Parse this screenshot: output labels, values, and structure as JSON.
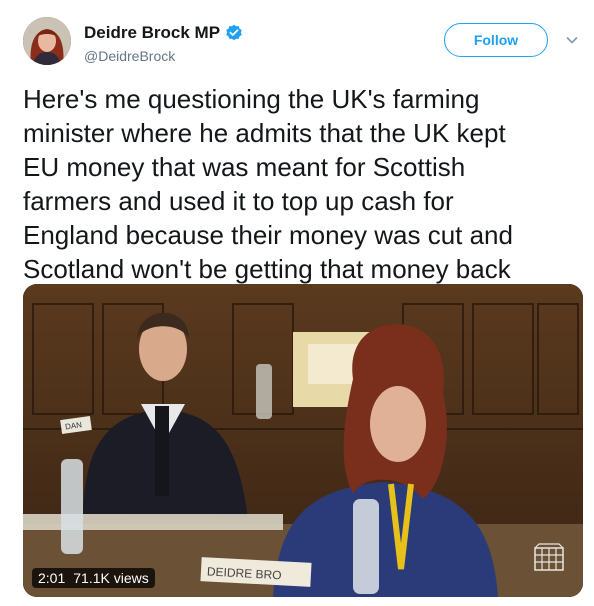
{
  "header": {
    "display_name": "Deidre Brock MP",
    "handle": "@DeidreBrock",
    "follow_label": "Follow"
  },
  "tweet": {
    "lines": [
      "Here's me questioning the UK's farming",
      "minister where he admits that the UK kept",
      "EU money that was meant for Scottish",
      "farmers and used it to top up cash for",
      "England because their money was cut and",
      "Scotland won't be getting that money back"
    ]
  },
  "media": {
    "duration": "2:01",
    "views": "71.1K views",
    "nameplate_left": "DAN",
    "nameplate_right": "DEIDRE BRO"
  },
  "colors": {
    "accent": "#1da1f2",
    "handle": "#657786",
    "text": "#14171a"
  },
  "icons": {
    "verified": "verified-badge-icon",
    "caret": "chevron-down-icon",
    "watermark": "portcullis-icon"
  }
}
